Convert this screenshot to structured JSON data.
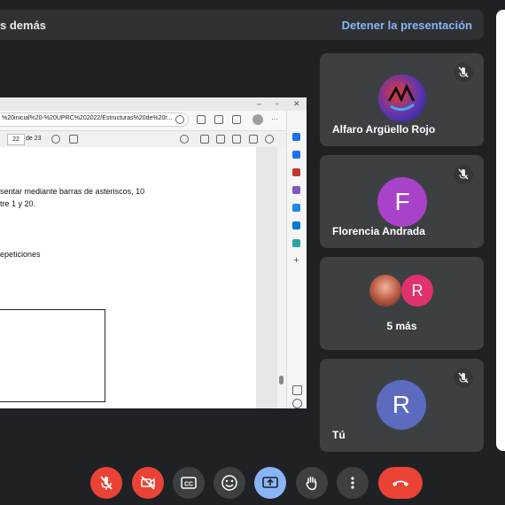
{
  "banner": {
    "text": "s demás",
    "stop_label": "Detener la presentación"
  },
  "shared_screen": {
    "url": "%20inicial%20-%20UPRC%202022/Estructuras%20de%20r...",
    "page_current": "22",
    "page_total": "de 23",
    "doc_lines": [
      "sentar mediante barras de asteriscos, 10",
      "tre 1 y 20.",
      "epeticiones"
    ]
  },
  "participants": [
    {
      "name": "Alfaro Argüello Rojo",
      "avatar": "graffiti",
      "muted": true
    },
    {
      "name": "Florencia Andrada",
      "initial": "F",
      "color": "#a842c8",
      "muted": true
    },
    {
      "more_label": "5 más",
      "initial": "R",
      "color": "#e0326e"
    },
    {
      "name": "Tú",
      "initial": "R",
      "color": "#5c6bc0",
      "muted": true
    }
  ],
  "controls": {
    "mic": "mic-off-icon",
    "camera": "camera-off-icon",
    "captions_text": "CC",
    "colors": {
      "danger": "#ea4335",
      "default": "#3c4043",
      "active": "#8ab4f8"
    }
  }
}
